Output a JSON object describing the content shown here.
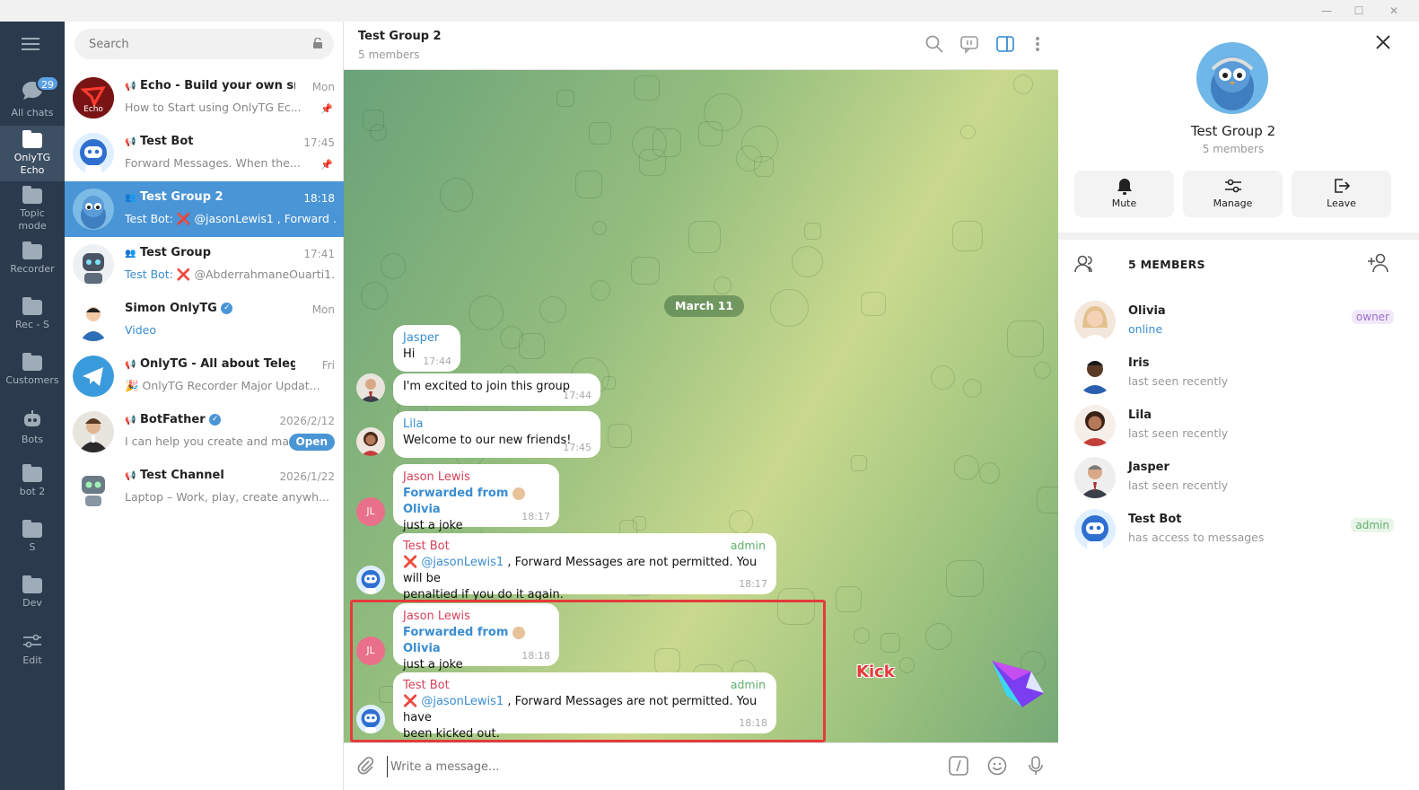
{
  "window": {
    "minimize": "—",
    "maximize": "☐",
    "close": "✕"
  },
  "rail": {
    "all_chats_label": "All chats",
    "all_chats_badge": "29",
    "folders": [
      {
        "label": "OnlyTG",
        "label2": "Echo"
      },
      {
        "label": "Topic",
        "label2": "mode"
      },
      {
        "label": "Recorder",
        "label2": ""
      },
      {
        "label": "Rec - S",
        "label2": ""
      },
      {
        "label": "Customers",
        "label2": ""
      },
      {
        "label": "Bots",
        "label2": ""
      },
      {
        "label": "bot 2",
        "label2": ""
      },
      {
        "label": "S",
        "label2": ""
      },
      {
        "label": "Dev",
        "label2": ""
      },
      {
        "label": "Edit",
        "label2": ""
      }
    ]
  },
  "search": {
    "placeholder": "Search"
  },
  "chats": [
    {
      "name": "Echo - Build your own smar...",
      "time": "Mon",
      "preview": "How to Start using OnlyTG Ec...",
      "avatar_text": "Echo"
    },
    {
      "name": "Test Bot",
      "time": "17:45",
      "preview": "Forward Messages. When the..."
    },
    {
      "name": "Test Group 2",
      "time": "18:18",
      "sender": "Test Bot:",
      "mark": "❌",
      "preview": "@jasonLewis1 , Forward ..."
    },
    {
      "name": "Test Group",
      "time": "17:41",
      "sender": "Test Bot:",
      "mark": "❌",
      "preview": "@AbderrahmaneOuarti1..."
    },
    {
      "name": "Simon OnlyTG",
      "time": "Mon",
      "preview": "Video"
    },
    {
      "name": "OnlyTG - All about Telegram",
      "time": "Fri",
      "preview": "🎉 OnlyTG Recorder Major Updat..."
    },
    {
      "name": "BotFather",
      "time": "2026/2/12",
      "preview": "I can help you create and ma...",
      "button": "Open"
    },
    {
      "name": "Test Channel",
      "time": "2026/1/22",
      "preview": "Laptop – Work, play, create anywh..."
    }
  ],
  "header": {
    "title": "Test Group 2",
    "subtitle": "5 members"
  },
  "date_pill": "March 11",
  "messages": [
    {
      "author": "Jasper",
      "text": "Hi",
      "time": "17:44"
    },
    {
      "text": "I'm excited to join this group",
      "time": "17:44"
    },
    {
      "author": "Lila",
      "text": "Welcome to our new friends!",
      "time": "17:45"
    },
    {
      "author": "Jason Lewis",
      "fwd_prefix": "Forwarded from",
      "fwd_name": "Olivia",
      "text": "just a joke",
      "time": "18:17",
      "avatar": "JL"
    },
    {
      "author": "Test Bot",
      "role": "admin",
      "mark": "❌",
      "mention": "@jasonLewis1",
      "text": " , Forward Messages are not permitted. You will be",
      "text2": "penaltied if you do it again.",
      "time": "18:17"
    },
    {
      "author": "Jason Lewis",
      "fwd_prefix": "Forwarded from",
      "fwd_name": "Olivia",
      "text": "just a joke",
      "time": "18:18",
      "avatar": "JL"
    },
    {
      "author": "Test Bot",
      "role": "admin",
      "mark": "❌",
      "mention": "@jasonLewis1",
      "text": " , Forward Messages are not permitted. You have",
      "text2": "been kicked out.",
      "time": "18:18"
    }
  ],
  "annotation": "Kick",
  "composer": {
    "placeholder": "Write a message..."
  },
  "side": {
    "title": "Test Group 2",
    "subtitle": "5 members",
    "actions": [
      {
        "label": "Mute"
      },
      {
        "label": "Manage"
      },
      {
        "label": "Leave"
      }
    ],
    "members_title": "5 MEMBERS",
    "members": [
      {
        "name": "Olivia",
        "status": "online",
        "role": "owner"
      },
      {
        "name": "Iris",
        "status": "last seen recently",
        "role": ""
      },
      {
        "name": "Lila",
        "status": "last seen recently",
        "role": ""
      },
      {
        "name": "Jasper",
        "status": "last seen recently",
        "role": ""
      },
      {
        "name": "Test Bot",
        "status": "has access to messages",
        "role": "admin"
      }
    ]
  },
  "colors": {
    "accent": "#4a95d6",
    "rail": "#2b3a4c",
    "admin": "#5fae6a",
    "owner": "#9b6fc9",
    "kick": "#e33b3b",
    "author_red": "#d7415a",
    "author_blue": "#3a8dd0"
  }
}
